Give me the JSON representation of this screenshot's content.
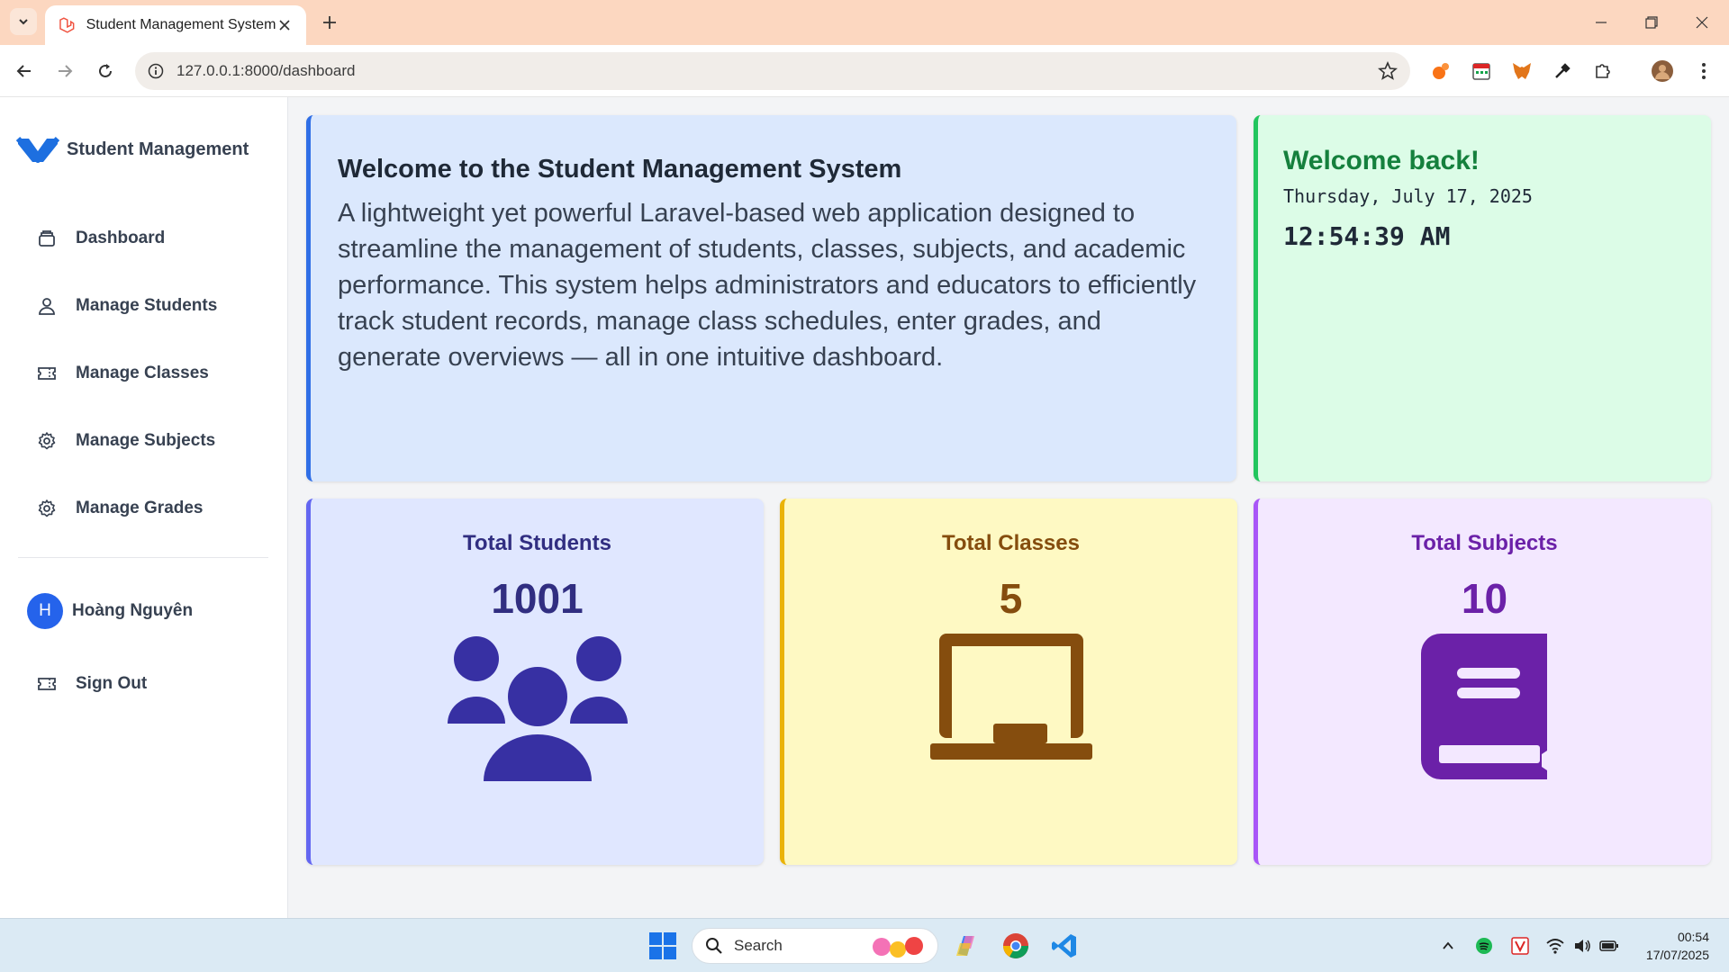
{
  "browser": {
    "tab_title": "Student Management System",
    "url": "127.0.0.1:8000/dashboard"
  },
  "sidebar": {
    "brand": "Student Management",
    "items": [
      {
        "label": "Dashboard",
        "icon": "dashboard-icon"
      },
      {
        "label": "Manage Students",
        "icon": "user-icon"
      },
      {
        "label": "Manage Classes",
        "icon": "ticket-icon"
      },
      {
        "label": "Manage Subjects",
        "icon": "gear-icon"
      },
      {
        "label": "Manage Grades",
        "icon": "gear-icon"
      }
    ],
    "user": {
      "initial": "H",
      "name": "Hoàng Nguyên"
    },
    "signout": "Sign Out"
  },
  "welcome": {
    "title": "Welcome to the Student Management System",
    "body": "A lightweight yet powerful Laravel-based web application designed to streamline the management of students, classes, subjects, and academic performance. This system helps administrators and educators to efficiently track student records, manage class schedules, enter grades, and generate overviews — all in one intuitive dashboard."
  },
  "greeting": {
    "title": "Welcome back!",
    "date": "Thursday, July 17, 2025",
    "time": "12:54:39 AM"
  },
  "stats": [
    {
      "title": "Total Students",
      "value": "1001",
      "icon": "users-icon"
    },
    {
      "title": "Total Classes",
      "value": "5",
      "icon": "chalkboard-icon"
    },
    {
      "title": "Total Subjects",
      "value": "10",
      "icon": "book-icon"
    }
  ],
  "taskbar": {
    "search_placeholder": "Search",
    "time": "00:54",
    "date": "17/07/2025"
  },
  "colors": {
    "tabbar": "#fcd7c0",
    "welcome_bg": "#dbe8fd",
    "greeting_bg": "#dcfce7",
    "students_bg": "#e0e7ff",
    "classes_bg": "#fef9c3",
    "subjects_bg": "#f3e8ff"
  }
}
